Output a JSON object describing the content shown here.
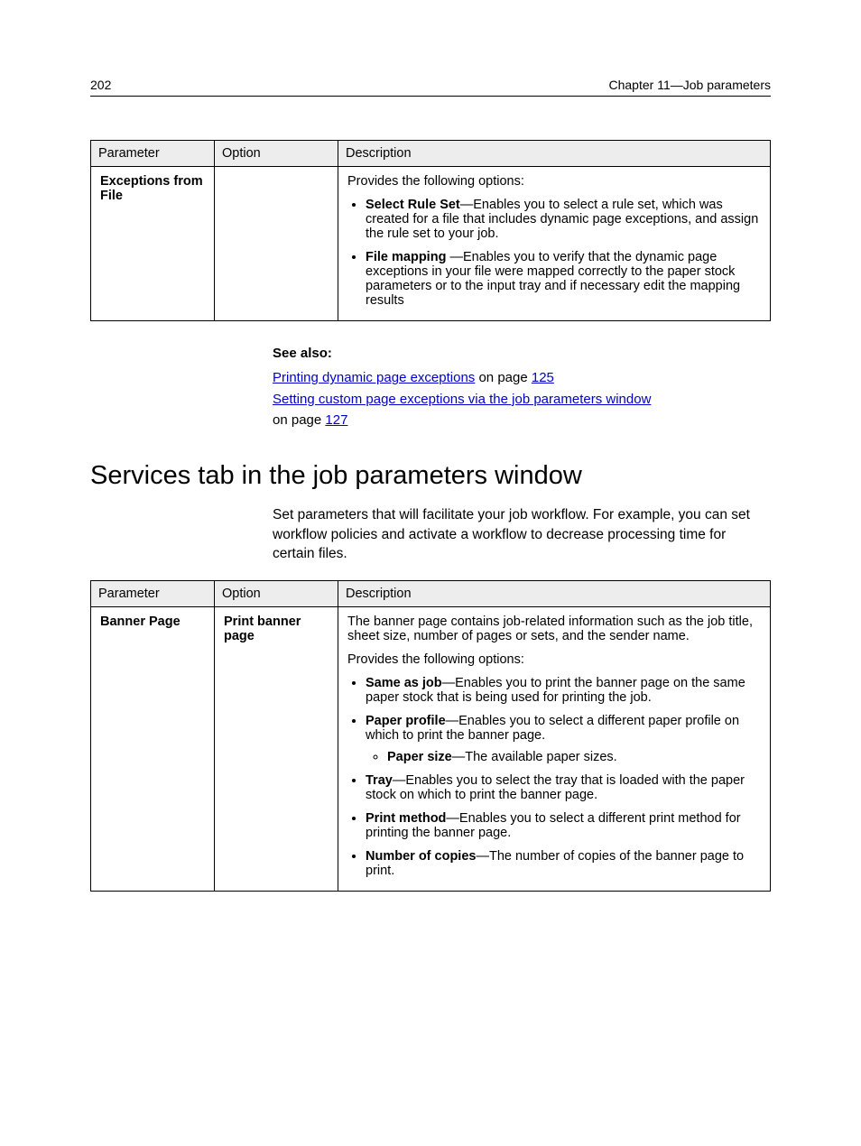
{
  "page_number": "202",
  "chapter_label": "Chapter 11—Job parameters",
  "table1": {
    "headers": {
      "parameter": "Parameter",
      "option": "Option",
      "description": "Description"
    },
    "row1": {
      "parameter": "Exceptions from File",
      "option": "",
      "desc_intro": "Provides the following options:",
      "b1_label": "Select Rule Set",
      "b1_rest": "—Enables you to select a rule set, which was created for a file that includes dynamic page exceptions, and assign the rule set to your job.",
      "b2_label": "File mapping ",
      "b2_rest": "—Enables you to verify that the dynamic page exceptions in your file were mapped correctly to the paper stock parameters or to the input tray and if necessary edit the mapping results"
    }
  },
  "see_also": {
    "heading": "See also:",
    "link1_text": "Printing dynamic page exceptions",
    "link1_tail": " on page ",
    "link1_page": "125",
    "link2_text": "Setting custom page exceptions via the job parameters window",
    "link2_tail": "on page ",
    "link2_page": "127"
  },
  "section_heading": "Services tab in the job parameters window",
  "section_intro": "Set parameters that will facilitate your job workflow. For example, you can set workflow policies and activate a workflow to decrease processing time for certain files.",
  "table2": {
    "headers": {
      "parameter": "Parameter",
      "option": "Option",
      "description": "Description"
    },
    "row1": {
      "parameter": "Banner Page",
      "option": "Print banner page",
      "p1": "The banner page contains job-related information such as the job title, sheet size, number of pages or sets, and the sender name.",
      "p2": "Provides the following options:",
      "b1_label": "Same as job",
      "b1_rest": "—Enables you to print the banner page on the same paper stock that is being used for printing the job.",
      "b2_label": "Paper profile",
      "b2_rest": "—Enables you to select a different paper profile on which to print the banner page.",
      "b2_sub_label": "Paper size",
      "b2_sub_rest": "—The available paper sizes.",
      "b3_label": "Tray",
      "b3_rest": "—Enables you to select the tray that is loaded with the paper stock on which to print the banner page.",
      "b4_label": "Print method",
      "b4_rest": "—Enables you to select a different print method for printing the banner page.",
      "b5_label": "Number of copies",
      "b5_rest": "—The number of copies of the banner page to print."
    }
  }
}
